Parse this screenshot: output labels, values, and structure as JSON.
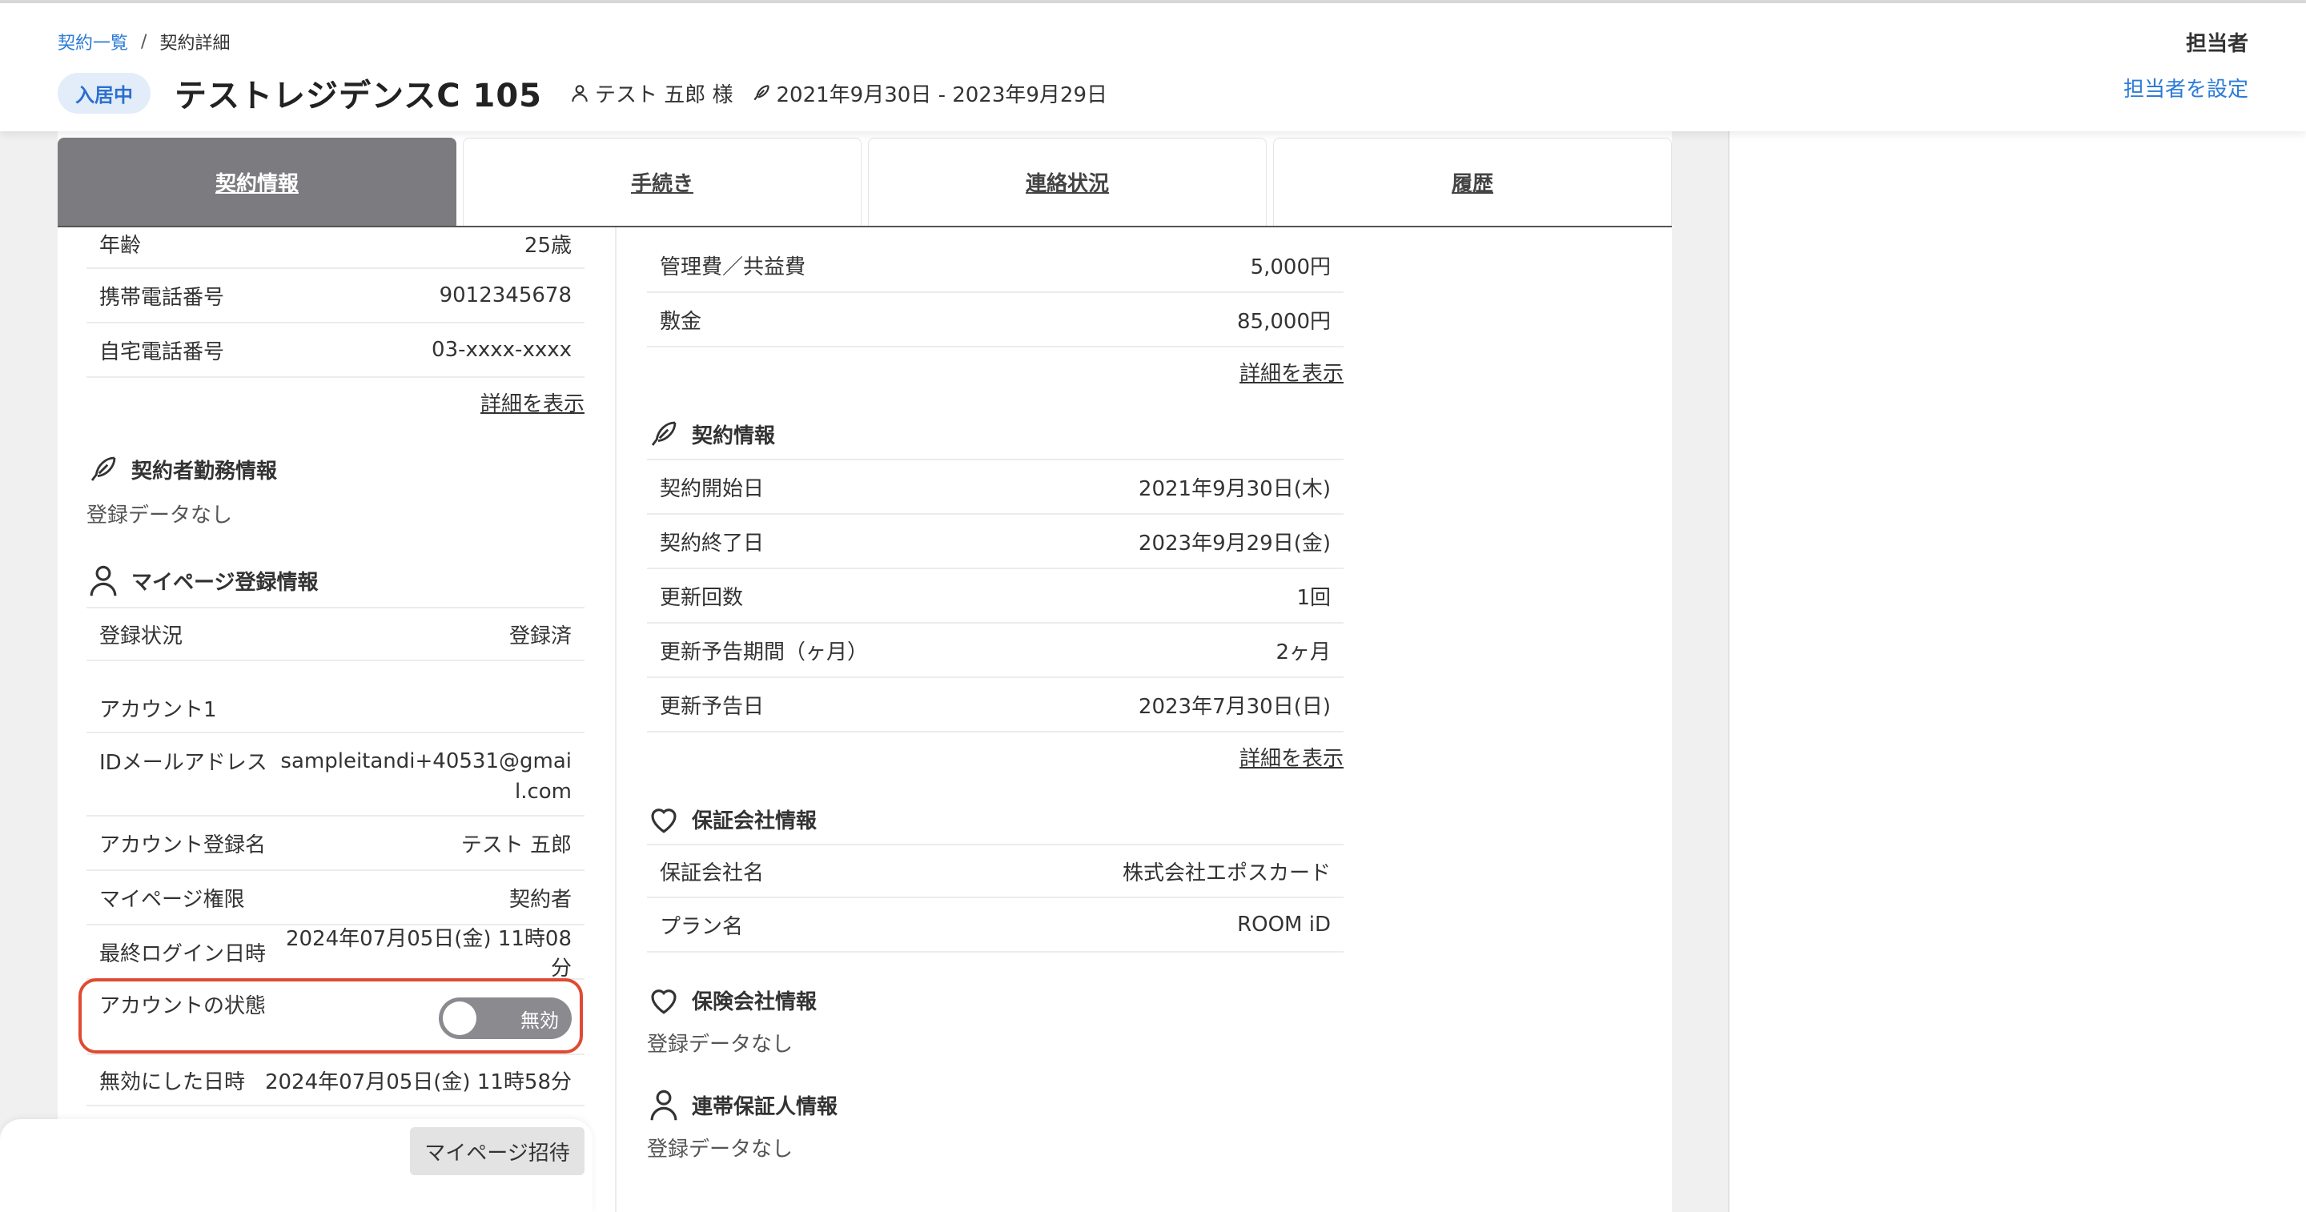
{
  "breadcrumb": {
    "list": "契約一覧",
    "separator": "/",
    "current": "契約詳細"
  },
  "header": {
    "status_badge": "入居中",
    "title": "テストレジデンスC 105",
    "tenant": "テスト 五郎 様",
    "period": "2021年9月30日 - 2023年9月29日"
  },
  "assignee": {
    "label": "担当者",
    "set_link": "担当者を設定"
  },
  "tabs": [
    {
      "label": "契約情報",
      "active": true
    },
    {
      "label": "手続き",
      "active": false
    },
    {
      "label": "連絡状況",
      "active": false
    },
    {
      "label": "履歴",
      "active": false
    }
  ],
  "left": {
    "contractor_rows": [
      {
        "label": "年齢",
        "value": "25歳"
      },
      {
        "label": "携帯電話番号",
        "value": "9012345678"
      },
      {
        "label": "自宅電話番号",
        "value": "03-xxxx-xxxx"
      }
    ],
    "show_details": "詳細を表示",
    "employment": {
      "title": "契約者勤務情報",
      "nodata": "登録データなし"
    },
    "mypage": {
      "title": "マイページ登録情報",
      "status_label": "登録状況",
      "status_value": "登録済",
      "account_heading": "アカウント1",
      "email_label": "IDメールアドレス",
      "email_value": "sampleitandi+40531@gmail.com",
      "name_label": "アカウント登録名",
      "name_value": "テスト 五郎",
      "role_label": "マイページ権限",
      "role_value": "契約者",
      "last_login_label": "最終ログイン日時",
      "last_login_value": "2024年07月05日(金) 11時08分",
      "account_state_label": "アカウントの状態",
      "account_state_value": "無効",
      "disabled_at_label": "無効にした日時",
      "disabled_at_value": "2024年07月05日(金) 11時58分",
      "invite_button": "マイページ招待"
    }
  },
  "middle": {
    "fee_rows": [
      {
        "label": "管理費／共益費",
        "value": "5,000円"
      },
      {
        "label": "敷金",
        "value": "85,000円"
      }
    ],
    "show_details_1": "詳細を表示",
    "contract": {
      "title": "契約情報",
      "rows": [
        {
          "label": "契約開始日",
          "value": "2021年9月30日(木)"
        },
        {
          "label": "契約終了日",
          "value": "2023年9月29日(金)"
        },
        {
          "label": "更新回数",
          "value": "1回"
        },
        {
          "label": "更新予告期間（ヶ月）",
          "value": "2ヶ月"
        },
        {
          "label": "更新予告日",
          "value": "2023年7月30日(日)"
        }
      ]
    },
    "show_details_2": "詳細を表示",
    "guarantee": {
      "title": "保証会社情報",
      "rows": [
        {
          "label": "保証会社名",
          "value": "株式会社エポスカード"
        },
        {
          "label": "プラン名",
          "value": "ROOM iD"
        }
      ]
    },
    "insurance": {
      "title": "保険会社情報",
      "nodata": "登録データなし"
    },
    "joint_guarantor": {
      "title": "連帯保証人情報",
      "nodata": "登録データなし"
    }
  }
}
